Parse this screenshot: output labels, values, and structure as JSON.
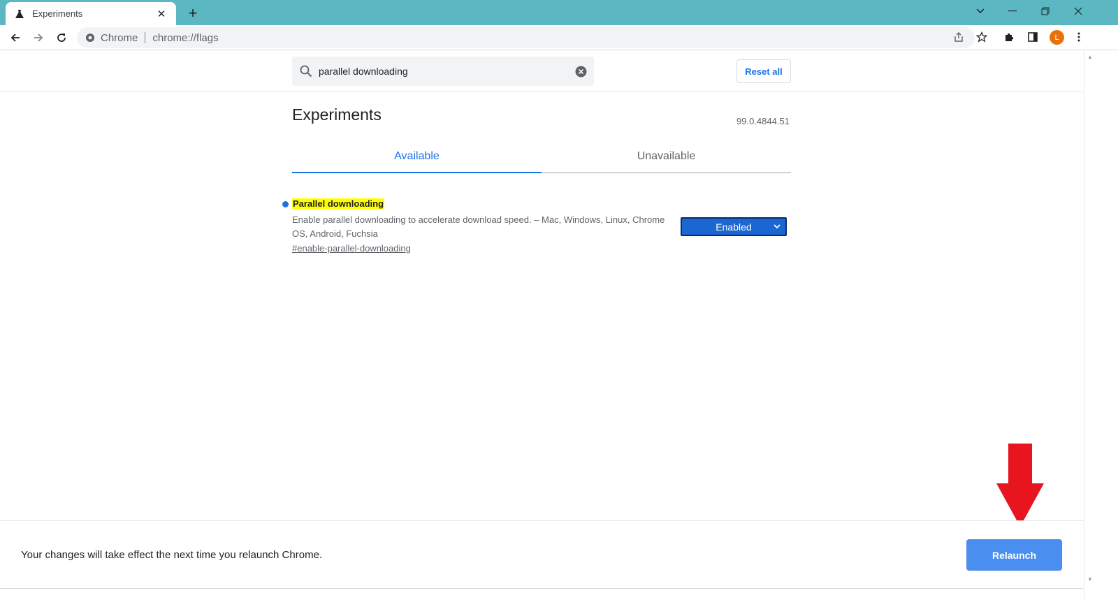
{
  "browser": {
    "tab_title": "Experiments",
    "omnibox_chip": "Chrome",
    "url": "chrome://flags",
    "profile_initial": "L"
  },
  "search": {
    "value": "parallel downloading",
    "reset_label": "Reset all"
  },
  "main": {
    "title": "Experiments",
    "version": "99.0.4844.51",
    "tabs": [
      {
        "label": "Available",
        "active": true
      },
      {
        "label": "Unavailable",
        "active": false
      }
    ]
  },
  "flag": {
    "name": "Parallel downloading",
    "description": "Enable parallel downloading to accelerate download speed. – Mac, Windows, Linux, Chrome OS, Android, Fuchsia",
    "link": "#enable-parallel-downloading",
    "selected": "Enabled"
  },
  "relaunch": {
    "message": "Your changes will take effect the next time you relaunch Chrome.",
    "button_label": "Relaunch"
  },
  "colors": {
    "tabstrip": "#5bb7c2",
    "accent": "#1a73e8",
    "highlight": "#ffff00",
    "annotation": "#e8141e"
  },
  "icons": {
    "tab_favicon": "flask-icon",
    "search": "search-icon",
    "clear": "clear-circle-icon",
    "annotation": "red-down-arrow"
  }
}
